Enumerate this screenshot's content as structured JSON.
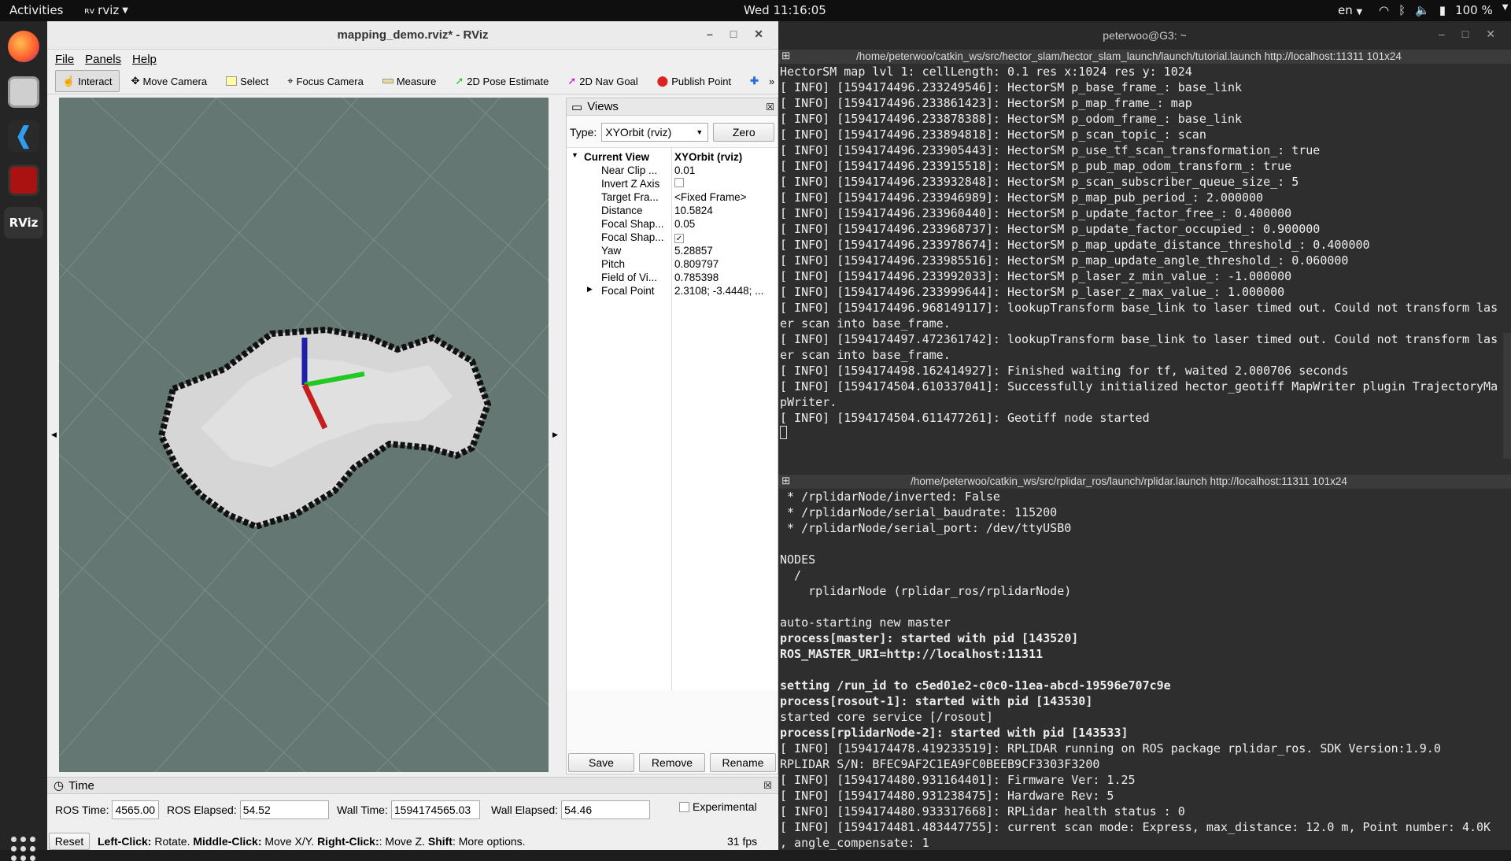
{
  "topbar": {
    "activities": "Activities",
    "app": "rviz",
    "clock": "Wed 11:16:05",
    "lang": "en",
    "battery": "100 %"
  },
  "rviz": {
    "title": "mapping_demo.rviz* - RViz",
    "menu": [
      "File",
      "Panels",
      "Help"
    ],
    "toolbar": [
      "Interact",
      "Move Camera",
      "Select",
      "Focus Camera",
      "Measure",
      "2D Pose Estimate",
      "2D Nav Goal",
      "Publish Point"
    ],
    "views": {
      "header": "Views",
      "type_label": "Type:",
      "type_value": "XYOrbit (rviz)",
      "zero": "Zero",
      "rows": [
        {
          "k": "Current View",
          "v": "XYOrbit (rviz)"
        },
        {
          "k": "Near Clip ...",
          "v": "0.01"
        },
        {
          "k": "Invert Z Axis",
          "v": ""
        },
        {
          "k": "Target Fra...",
          "v": "<Fixed Frame>"
        },
        {
          "k": "Distance",
          "v": "10.5824"
        },
        {
          "k": "Focal Shap...",
          "v": "0.05"
        },
        {
          "k": "Focal Shap...",
          "v": "✓"
        },
        {
          "k": "Yaw",
          "v": "5.28857"
        },
        {
          "k": "Pitch",
          "v": "0.809797"
        },
        {
          "k": "Field of Vi...",
          "v": "0.785398"
        },
        {
          "k": "Focal Point",
          "v": "2.3108; -3.4448; ..."
        }
      ],
      "save": "Save",
      "remove": "Remove",
      "rename": "Rename"
    },
    "time": {
      "header": "Time",
      "ros_time_label": "ROS Time:",
      "ros_time": "4565.00",
      "ros_elapsed_label": "ROS Elapsed:",
      "ros_elapsed": "54.52",
      "wall_time_label": "Wall Time:",
      "wall_time": "1594174565.03",
      "wall_elapsed_label": "Wall Elapsed:",
      "wall_elapsed": "54.46",
      "experimental": "Experimental"
    },
    "status": {
      "reset": "Reset",
      "left": "Left-Click:",
      "left_t": " Rotate. ",
      "middle": "Middle-Click:",
      "middle_t": " Move X/Y. ",
      "right": "Right-Click:",
      "right_t": ": Move Z. ",
      "shift": "Shift",
      "shift_t": ": More options.",
      "fps": "31 fps"
    }
  },
  "terminal": {
    "title": "peterwoo@G3: ~",
    "pane1_title": "/home/peterwoo/catkin_ws/src/hector_slam/hector_slam_launch/launch/tutorial.launch http://localhost:11311 101x24",
    "pane1_lines": [
      "HectorSM map lvl 1: cellLength: 0.1 res x:1024 res y: 1024",
      "[ INFO] [1594174496.233249546]: HectorSM p_base_frame_: base_link",
      "[ INFO] [1594174496.233861423]: HectorSM p_map_frame_: map",
      "[ INFO] [1594174496.233878388]: HectorSM p_odom_frame_: base_link",
      "[ INFO] [1594174496.233894818]: HectorSM p_scan_topic_: scan",
      "[ INFO] [1594174496.233905443]: HectorSM p_use_tf_scan_transformation_: true",
      "[ INFO] [1594174496.233915518]: HectorSM p_pub_map_odom_transform_: true",
      "[ INFO] [1594174496.233932848]: HectorSM p_scan_subscriber_queue_size_: 5",
      "[ INFO] [1594174496.233946989]: HectorSM p_map_pub_period_: 2.000000",
      "[ INFO] [1594174496.233960440]: HectorSM p_update_factor_free_: 0.400000",
      "[ INFO] [1594174496.233968737]: HectorSM p_update_factor_occupied_: 0.900000",
      "[ INFO] [1594174496.233978674]: HectorSM p_map_update_distance_threshold_: 0.400000",
      "[ INFO] [1594174496.233985516]: HectorSM p_map_update_angle_threshold_: 0.060000",
      "[ INFO] [1594174496.233992033]: HectorSM p_laser_z_min_value_: -1.000000",
      "[ INFO] [1594174496.233999644]: HectorSM p_laser_z_max_value_: 1.000000",
      "[ INFO] [1594174496.968149117]: lookupTransform base_link to laser timed out. Could not transform las",
      "er scan into base_frame.",
      "[ INFO] [1594174497.472361742]: lookupTransform base_link to laser timed out. Could not transform las",
      "er scan into base_frame.",
      "[ INFO] [1594174498.162414927]: Finished waiting for tf, waited 2.000706 seconds",
      "[ INFO] [1594174504.610337041]: Successfully initialized hector_geotiff MapWriter plugin TrajectoryMa",
      "pWriter.",
      "[ INFO] [1594174504.611477261]: Geotiff node started"
    ],
    "pane2_title": "/home/peterwoo/catkin_ws/src/rplidar_ros/launch/rplidar.launch http://localhost:11311 101x24",
    "pane2_lines": [
      {
        "t": " * /rplidarNode/inverted: False",
        "b": false
      },
      {
        "t": " * /rplidarNode/serial_baudrate: 115200",
        "b": false
      },
      {
        "t": " * /rplidarNode/serial_port: /dev/ttyUSB0",
        "b": false
      },
      {
        "t": "",
        "b": false
      },
      {
        "t": "NODES",
        "b": false
      },
      {
        "t": "  /",
        "b": false
      },
      {
        "t": "    rplidarNode (rplidar_ros/rplidarNode)",
        "b": false
      },
      {
        "t": "",
        "b": false
      },
      {
        "t": "auto-starting new master",
        "b": false
      },
      {
        "t": "process[master]: started with pid [143520]",
        "b": true
      },
      {
        "t": "ROS_MASTER_URI=http://localhost:11311",
        "b": true
      },
      {
        "t": "",
        "b": false
      },
      {
        "t": "setting /run_id to c5ed01e2-c0c0-11ea-abcd-19596e707c9e",
        "b": true
      },
      {
        "t": "process[rosout-1]: started with pid [143530]",
        "b": true
      },
      {
        "t": "started core service [/rosout]",
        "b": false
      },
      {
        "t": "process[rplidarNode-2]: started with pid [143533]",
        "b": true
      },
      {
        "t": "[ INFO] [1594174478.419233519]: RPLIDAR running on ROS package rplidar_ros. SDK Version:1.9.0",
        "b": false
      },
      {
        "t": "RPLIDAR S/N: BFEC9AF2C1EA9FC0BEEB9CF3303F3200",
        "b": false
      },
      {
        "t": "[ INFO] [1594174480.931164401]: Firmware Ver: 1.25",
        "b": false
      },
      {
        "t": "[ INFO] [1594174480.931238475]: Hardware Rev: 5",
        "b": false
      },
      {
        "t": "[ INFO] [1594174480.933317668]: RPLidar health status : 0",
        "b": false
      },
      {
        "t": "[ INFO] [1594174481.483447755]: current scan mode: Express, max_distance: 12.0 m, Point number: 4.0K",
        "b": false
      },
      {
        "t": ", angle_compensate: 1",
        "b": false
      }
    ]
  }
}
